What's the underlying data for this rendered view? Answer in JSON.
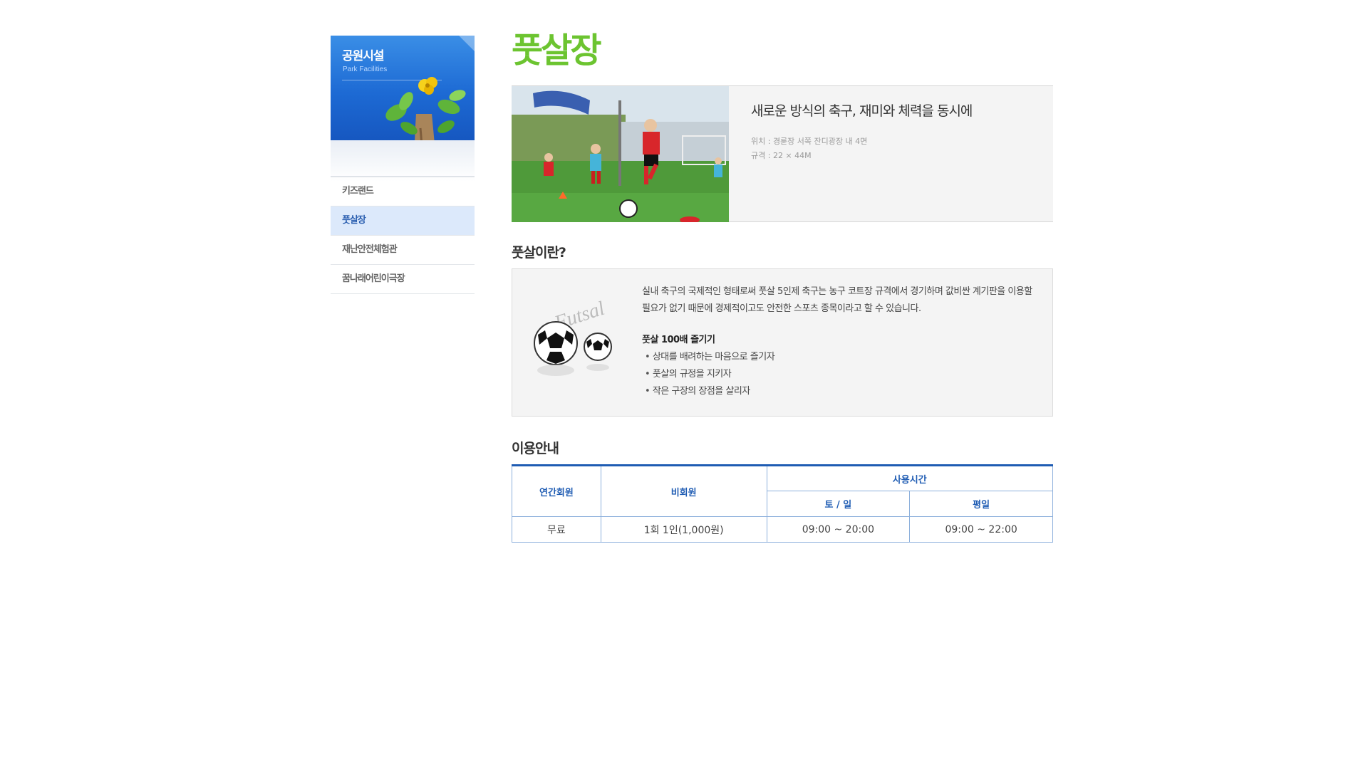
{
  "sidebar": {
    "title": "공원시설",
    "subtitle": "Park Facilities",
    "items": [
      {
        "label": "키즈랜드",
        "active": false
      },
      {
        "label": "풋살장",
        "active": true
      },
      {
        "label": "재난안전체험관",
        "active": false
      },
      {
        "label": "꿈나래어린이극장",
        "active": false
      }
    ]
  },
  "main": {
    "page_title": "풋살장",
    "intro": {
      "headline": "새로운 방식의 축구, 재미와 체력을 동시에",
      "location": "위치 : 경륜장 서쪽 잔디광장 내 4면",
      "size": "규격 : 22 × 44M",
      "photo_icon": "futsal-kids-photo"
    },
    "about": {
      "title": "풋살이란?",
      "description": "실내 축구의 국제적인 형태로써 풋살 5인제 축구는 농구 코트장 규격에서 경기하며 값비싼 계기판을 이용할 필요가 없기 때문에 경제적이고도 안전한 스포츠 종목이라고 할 수 있습니다.",
      "enjoy_title": "풋살 100배 즐기기",
      "enjoy_items": [
        "상대를 배려하는 마음으로 즐기자",
        "풋살의 규정을 지키자",
        "작은 구장의 장점을 살리자"
      ],
      "image_text": "Futsal"
    },
    "guide": {
      "title": "이용안내",
      "headers": {
        "annual": "연간회원",
        "non_member": "비회원",
        "hours": "사용시간",
        "weekend": "토 / 일",
        "weekday": "평일"
      },
      "row": {
        "annual": "무료",
        "non_member": "1회 1인(1,000원)",
        "weekend": "09:00 ~ 20:00",
        "weekday": "09:00 ~ 22:00"
      }
    }
  },
  "colors": {
    "title_green": "#6cc430",
    "sidebar_blue": "#1d6ad4",
    "table_blue": "#1f5cb3",
    "active_bg": "#dce9fb"
  }
}
